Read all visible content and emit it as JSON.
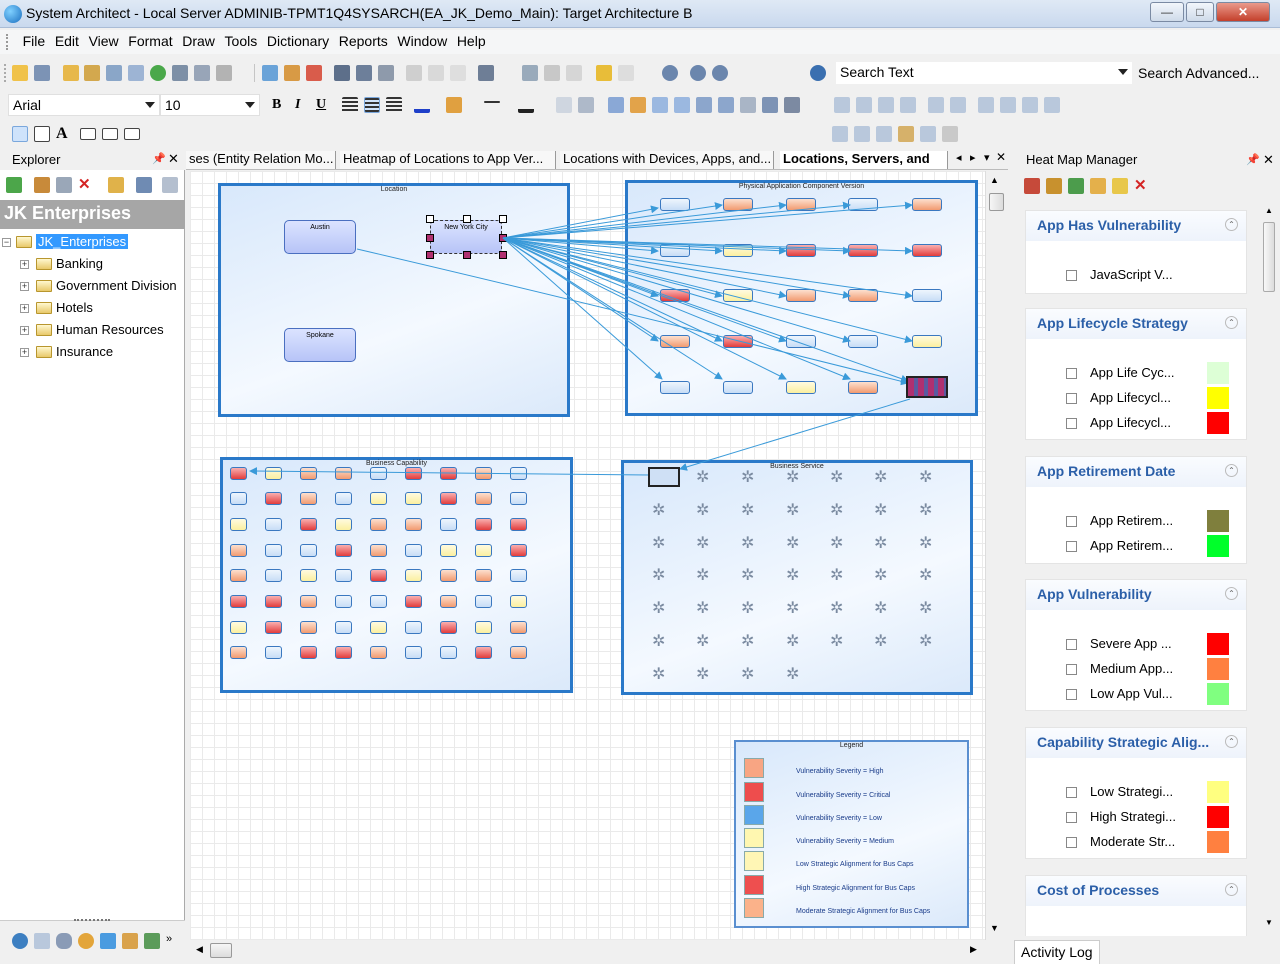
{
  "window": {
    "title": "System Architect - Local Server ADMINIB-TPMT1Q4SYSARCH(EA_JK_Demo_Main): Target Architecture B",
    "controls": {
      "minimize": "—",
      "maximize": "□",
      "close": "✕"
    }
  },
  "menu": [
    "File",
    "Edit",
    "View",
    "Format",
    "Draw",
    "Tools",
    "Dictionary",
    "Reports",
    "Window",
    "Help"
  ],
  "toolbar": {
    "search_text": "Search Text",
    "search_advanced": "Search Advanced...",
    "font_family": "Arial",
    "font_size": "10",
    "bold": "B",
    "italic": "I",
    "underline": "U"
  },
  "explorer": {
    "title": "Explorer",
    "heading": "JK Enterprises",
    "root": "JK_Enterprises",
    "items": [
      "Banking",
      "Government Division",
      "Hotels",
      "Human Resources",
      "Insurance"
    ]
  },
  "tabs": [
    {
      "label": "ses (Entity Relation Mo...",
      "active": false
    },
    {
      "label": "Heatmap of Locations to App Ver...",
      "active": false
    },
    {
      "label": "Locations with Devices, Apps, and...",
      "active": false
    },
    {
      "label": "Locations, Servers, and",
      "active": true
    }
  ],
  "diagram": {
    "location_frame": "Location",
    "locations": [
      "Austin",
      "New York City",
      "Spokane"
    ],
    "app_frame": "Physical Application Component Version",
    "capability_frame": "Business Capability",
    "service_frame": "Business Service",
    "legend": {
      "title": "Legend",
      "entries": [
        {
          "label": "Vulnerability Severity = High",
          "color": "#f8a583"
        },
        {
          "label": "Vulnerability Severity = Critical",
          "color": "#ee4d4d"
        },
        {
          "label": "Vulnerability Severity = Low",
          "color": "#5aa6ea"
        },
        {
          "label": "Vulnerability Severity = Medium",
          "color": "#fff7b0"
        },
        {
          "label": "Low Strategic Alignment for Bus Caps",
          "color": "#fff6b5"
        },
        {
          "label": "High Strategic Alignment for Bus Caps",
          "color": "#ee4f4f"
        },
        {
          "label": "Moderate Strategic Alignment for Bus Caps",
          "color": "#fbb28a"
        }
      ]
    }
  },
  "heatmap": {
    "title": "Heat Map Manager",
    "groups": [
      {
        "title": "App Has Vulnerability",
        "rows": [
          {
            "label": "JavaScript V...",
            "color": ""
          }
        ]
      },
      {
        "title": "App Lifecycle Strategy",
        "rows": [
          {
            "label": "App Life Cyc...",
            "color": "#ddffd6"
          },
          {
            "label": "App Lifecycl...",
            "color": "#ffff00"
          },
          {
            "label": "App Lifecycl...",
            "color": "#ff0000"
          }
        ]
      },
      {
        "title": "App Retirement Date",
        "rows": [
          {
            "label": "App Retirem...",
            "color": "#7f7f3d"
          },
          {
            "label": "App Retirem...",
            "color": "#00ff2a"
          }
        ]
      },
      {
        "title": "App Vulnerability",
        "rows": [
          {
            "label": "Severe App ...",
            "color": "#ff0000"
          },
          {
            "label": "Medium App...",
            "color": "#ff8040"
          },
          {
            "label": "Low App Vul...",
            "color": "#80ff80"
          }
        ]
      },
      {
        "title": "Capability Strategic Alig...",
        "rows": [
          {
            "label": "Low Strategi...",
            "color": "#ffff80"
          },
          {
            "label": "High Strategi...",
            "color": "#ff0000"
          },
          {
            "label": "Moderate Str...",
            "color": "#ff8040"
          }
        ]
      },
      {
        "title": "Cost of Processes",
        "rows": []
      }
    ]
  },
  "activity_log": "Activity Log"
}
